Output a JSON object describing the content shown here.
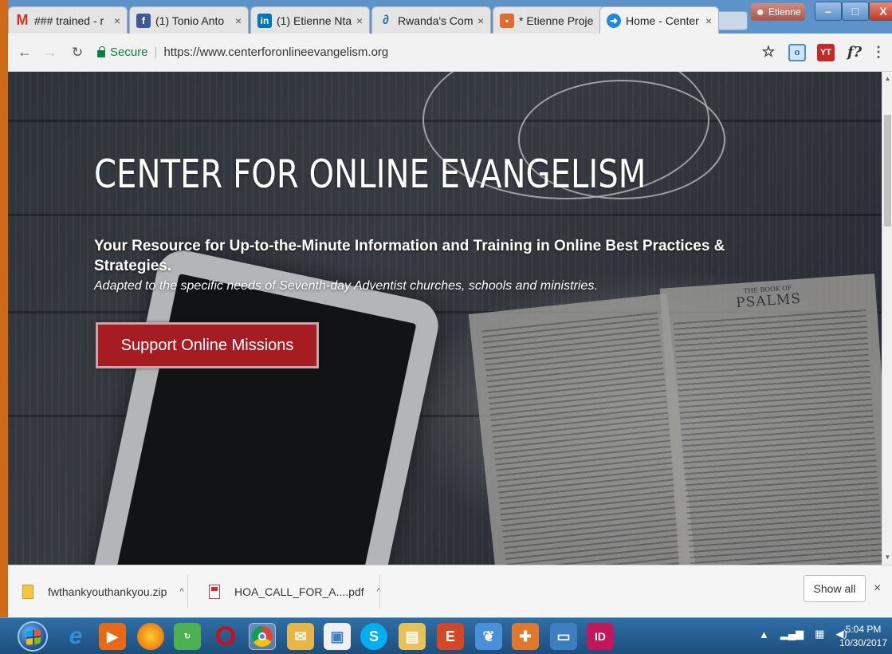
{
  "browser": {
    "tabs": [
      {
        "title": "### trained - r",
        "icon": "gmail-icon",
        "color": "#d93025"
      },
      {
        "title": "(1) Tonio Anto",
        "icon": "facebook-icon",
        "color": "#3b5998"
      },
      {
        "title": "(1) Etienne Nta",
        "icon": "linkedin-icon",
        "color": "#0077b5"
      },
      {
        "title": "Rwanda's Com",
        "icon": "feather-icon",
        "color": "#1a73a8"
      },
      {
        "title": "* Etienne Proje",
        "icon": "slides-icon",
        "color": "#e06b2f"
      },
      {
        "title": "Home - Center",
        "icon": "site-icon",
        "color": "#1e88e5"
      }
    ],
    "profile_name": "Etienne",
    "window_controls": {
      "minimize": "–",
      "maximize": "□",
      "close": "X"
    },
    "address": {
      "secure_label": "Secure",
      "url": "https://www.centerforonlineevangelism.org"
    },
    "extensions": [
      "star-icon",
      "office-extension-icon",
      "yt-extension-icon",
      "formula-extension-icon",
      "menu-icon"
    ]
  },
  "page": {
    "title": "CENTER FOR ONLINE EVANGELISM",
    "subtitle": "Your Resource for Up-to-the-Minute Information and Training in Online Best Practices & Strategies.",
    "tagline": "Adapted to the specific needs of Seventh-day Adventist churches, schools and ministries.",
    "cta_label": "Support Online Missions",
    "bible_heading_small": "THE BOOK OF",
    "bible_heading": "PSALMS"
  },
  "downloads": {
    "items": [
      {
        "filename": "fwthankyouthankyou.zip",
        "icon": "zip-file-icon"
      },
      {
        "filename": "HOA_CALL_FOR_A....pdf",
        "icon": "pdf-file-icon"
      }
    ],
    "show_all_label": "Show all",
    "close_glyph": "×"
  },
  "taskbar": {
    "apps": [
      {
        "name": "ie-icon",
        "color": "#2f8fd8"
      },
      {
        "name": "media-icon",
        "color": "#e86a17"
      },
      {
        "name": "firefox-icon",
        "color": "#e66000"
      },
      {
        "name": "mp4-converter-icon",
        "color": "#4caf50"
      },
      {
        "name": "opera-icon",
        "color": "#cc0f16"
      },
      {
        "name": "chrome-icon",
        "color": "#e8a91c"
      },
      {
        "name": "cleaner-icon",
        "color": "#e8b548"
      },
      {
        "name": "skype-icon",
        "color": "#00aff0"
      },
      {
        "name": "file-explorer-icon",
        "color": "#e8c15a"
      },
      {
        "name": "presentation-icon",
        "color": "#d24726"
      },
      {
        "name": "books-icon",
        "color": "#4a90d9"
      },
      {
        "name": "paint-icon",
        "color": "#e0782e"
      },
      {
        "name": "photos-icon",
        "color": "#3c7fc0"
      },
      {
        "name": "indesign-icon",
        "color": "#c2185b"
      }
    ],
    "clock_time": "5:04 PM",
    "clock_date": "10/30/2017"
  },
  "colors": {
    "cta_red": "#a71c22",
    "tab_strip": "#5e93c9",
    "taskbar": "#1d4e7d"
  }
}
